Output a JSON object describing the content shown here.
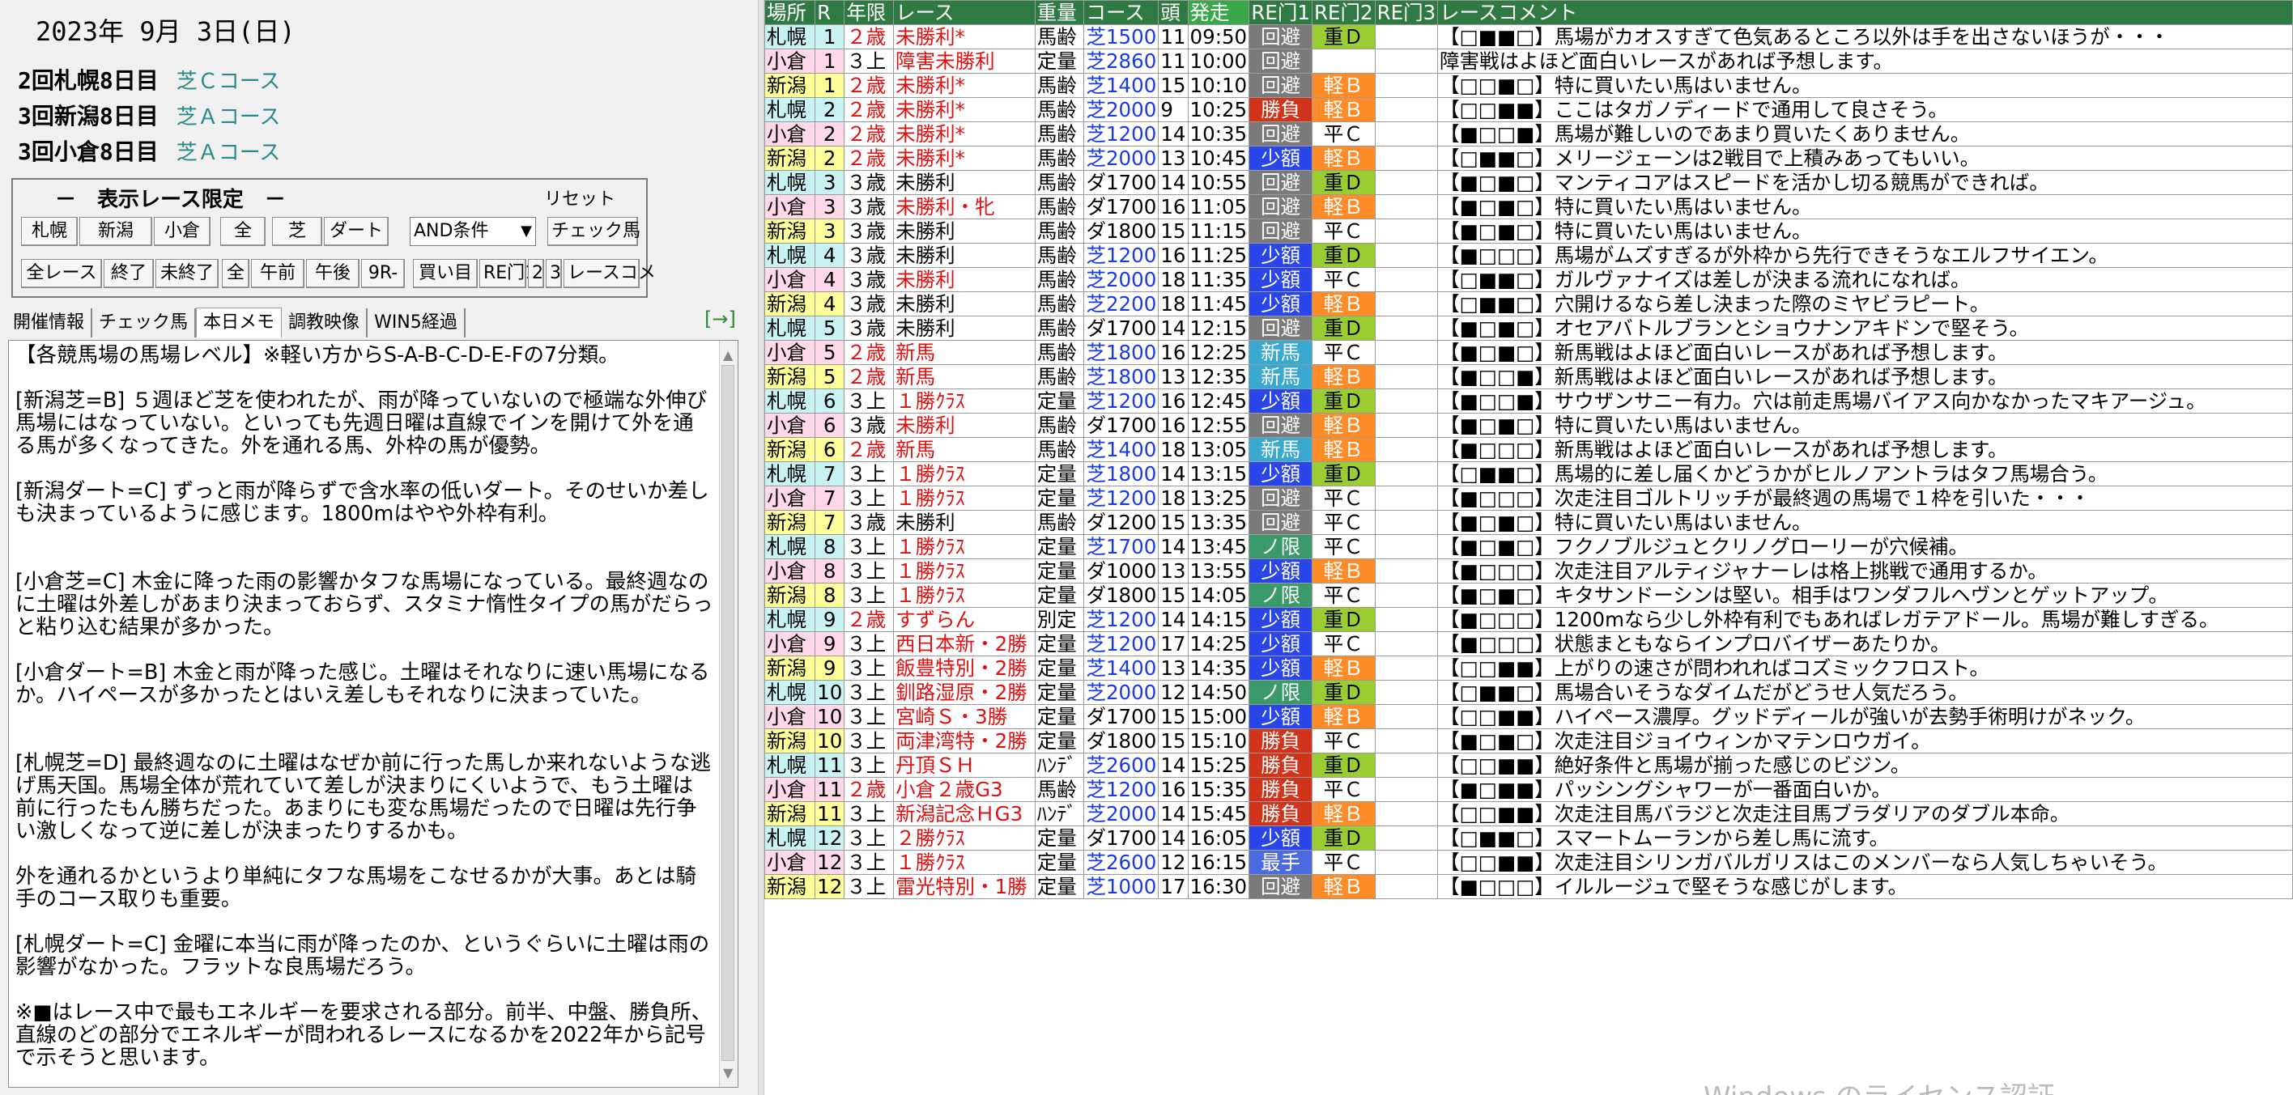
{
  "left": {
    "date": "2023年 9月 3日(日)",
    "venues": [
      {
        "label": "2回札幌8日目",
        "course": "芝Ｃコース"
      },
      {
        "label": "3回新潟8日目",
        "course": "芝Ａコース"
      },
      {
        "label": "3回小倉8日目",
        "course": "芝Ａコース"
      }
    ],
    "filter": {
      "title": "－　表示レース限定　－",
      "reset": "リセット",
      "row1": [
        "札幌",
        "新潟",
        "小倉",
        "全",
        "芝",
        "ダート"
      ],
      "condition": "AND条件",
      "check_horse": "チェック馬",
      "row2": [
        "全レース",
        "終了",
        "未終了",
        "全",
        "午前",
        "午後",
        "9R-",
        "買い目",
        "RE门1",
        "2",
        "3",
        "レースコメ"
      ]
    },
    "tabs": [
      "開催情報",
      "チェック馬",
      "本日メモ",
      "調教映像",
      "WIN5経過"
    ],
    "tab_arrow": "[→]",
    "memo": "【各競馬場の馬場レベル】※軽い方からS-A-B-C-D-E-Fの7分類。\n\n[新潟芝=B] ５週ほど芝を使われたが、雨が降っていないので極端な外伸び馬場にはなっていない。といっても先週日曜は直線でインを開けて外を通る馬が多くなってきた。外を通れる馬、外枠の馬が優勢。\n\n[新潟ダート=C] ずっと雨が降らずで含水率の低いダート。そのせいか差しも決まっているように感じます。1800mはやや外枠有利。\n\n\n[小倉芝=C] 木金に降った雨の影響かタフな馬場になっている。最終週なのに土曜は外差しがあまり決まっておらず、スタミナ惰性タイプの馬がだらっと粘り込む結果が多かった。\n\n[小倉ダート=B] 木金と雨が降った感じ。土曜はそれなりに速い馬場になるか。ハイペースが多かったとはいえ差しもそれなりに決まっていた。\n\n\n[札幌芝=D] 最終週なのに土曜はなぜか前に行った馬しか来れないような逃げ馬天国。馬場全体が荒れていて差しが決まりにくいようで、もう土曜は前に行ったもん勝ちだった。あまりにも変な馬場だったので日曜は先行争い激しくなって逆に差しが決まったりするかも。\n\n外を通れるかというより単純にタフな馬場をこなせるかが大事。あとは騎手のコース取りも重要。\n\n[札幌ダート=C] 金曜に本当に雨が降ったのか、というぐらいに土曜は雨の影響がなかった。フラットな良馬場だろう。\n\n※■はレース中で最もエネルギーを要求される部分。前半、中盤、勝負所、直線のどの部分でエネルギーが問われるレースになるかを2022年から記号で示そうと思います。"
  },
  "table": {
    "headers": [
      "場所",
      "R",
      "年限",
      "レース",
      "重量",
      "コース",
      "頭",
      "発走",
      "RE门1",
      "RE门2",
      "RE门3",
      "レースコメント"
    ],
    "rows": [
      {
        "venue": "札幌",
        "r": "1",
        "age": "２歳",
        "race": "未勝利*",
        "weight": "馬齢",
        "course": "芝1500",
        "heads": "11",
        "time": "09:50",
        "re1": "回避",
        "re2": "重Ｄ",
        "re3": "",
        "comment": "【□■■□】馬場がカオスすぎて色気あるところ以外は手を出さないほうが・・・"
      },
      {
        "venue": "小倉",
        "r": "1",
        "age": "３上",
        "race": "障害未勝利",
        "weight": "定量",
        "course": "芝2860",
        "heads": "11",
        "time": "10:00",
        "re1": "回避",
        "re2": "",
        "re3": "",
        "comment": "障害戦はよほど面白いレースがあれば予想します。"
      },
      {
        "venue": "新潟",
        "r": "1",
        "age": "２歳",
        "race": "未勝利*",
        "weight": "馬齢",
        "course": "芝1400",
        "heads": "15",
        "time": "10:10",
        "re1": "回避",
        "re2": "軽Ｂ",
        "re3": "",
        "comment": "【□□■□】特に買いたい馬はいません。"
      },
      {
        "venue": "札幌",
        "r": "2",
        "age": "２歳",
        "race": "未勝利*",
        "weight": "馬齢",
        "course": "芝2000",
        "heads": "9",
        "time": "10:25",
        "re1": "勝負",
        "re2": "軽Ｂ",
        "re3": "",
        "comment": "【□□■■】ここはタガノディードで通用して良さそう。"
      },
      {
        "venue": "小倉",
        "r": "2",
        "age": "２歳",
        "race": "未勝利*",
        "weight": "馬齢",
        "course": "芝1200",
        "heads": "14",
        "time": "10:35",
        "re1": "回避",
        "re2": "平Ｃ",
        "re3": "",
        "comment": "【■□□■】馬場が難しいのであまり買いたくありません。"
      },
      {
        "venue": "新潟",
        "r": "2",
        "age": "２歳",
        "race": "未勝利*",
        "weight": "馬齢",
        "course": "芝2000",
        "heads": "13",
        "time": "10:45",
        "re1": "少額",
        "re2": "軽Ｂ",
        "re3": "",
        "comment": "【□■■□】メリージェーンは2戦目で上積みあってもいい。"
      },
      {
        "venue": "札幌",
        "r": "3",
        "age": "３歳",
        "race": "未勝利",
        "weight": "馬齢",
        "course": "ダ1700",
        "heads": "14",
        "time": "10:55",
        "re1": "回避",
        "re2": "重Ｄ",
        "re3": "",
        "comment": "【■□■□】マンティコアはスピードを活かし切る競馬ができれば。"
      },
      {
        "venue": "小倉",
        "r": "3",
        "age": "３歳",
        "race": "未勝利・牝",
        "weight": "馬齢",
        "course": "ダ1700",
        "heads": "16",
        "time": "11:05",
        "re1": "回避",
        "re2": "軽Ｂ",
        "re3": "",
        "comment": "【■□■□】特に買いたい馬はいません。"
      },
      {
        "venue": "新潟",
        "r": "3",
        "age": "３歳",
        "race": "未勝利",
        "weight": "馬齢",
        "course": "ダ1800",
        "heads": "15",
        "time": "11:15",
        "re1": "回避",
        "re2": "平Ｃ",
        "re3": "",
        "comment": "【■□■□】特に買いたい馬はいません。"
      },
      {
        "venue": "札幌",
        "r": "4",
        "age": "３歳",
        "race": "未勝利",
        "weight": "馬齢",
        "course": "芝1200",
        "heads": "16",
        "time": "11:25",
        "re1": "少額",
        "re2": "重Ｄ",
        "re3": "",
        "comment": "【■□□□】馬場がムズすぎるが外枠から先行できそうなエルフサイエン。"
      },
      {
        "venue": "小倉",
        "r": "4",
        "age": "３歳",
        "race": "未勝利",
        "weight": "馬齢",
        "course": "芝2000",
        "heads": "18",
        "time": "11:35",
        "re1": "少額",
        "re2": "平Ｃ",
        "re3": "",
        "comment": "【□■■□】ガルヴァナイズは差しが決まる流れになれば。"
      },
      {
        "venue": "新潟",
        "r": "4",
        "age": "３歳",
        "race": "未勝利",
        "weight": "馬齢",
        "course": "芝2200",
        "heads": "18",
        "time": "11:45",
        "re1": "少額",
        "re2": "軽Ｂ",
        "re3": "",
        "comment": "【□■■□】穴開けるなら差し決まった際のミヤビラピート。"
      },
      {
        "venue": "札幌",
        "r": "5",
        "age": "３歳",
        "race": "未勝利",
        "weight": "馬齢",
        "course": "ダ1700",
        "heads": "14",
        "time": "12:15",
        "re1": "回避",
        "re2": "重Ｄ",
        "re3": "",
        "comment": "【■□■□】オセアバトルブランとショウナンアキドンで堅そう。"
      },
      {
        "venue": "小倉",
        "r": "5",
        "age": "２歳",
        "race": "新馬",
        "weight": "馬齢",
        "course": "芝1800",
        "heads": "16",
        "time": "12:25",
        "re1": "新馬",
        "re2": "平Ｃ",
        "re3": "",
        "comment": "【■□■□】新馬戦はよほど面白いレースがあれば予想します。"
      },
      {
        "venue": "新潟",
        "r": "5",
        "age": "２歳",
        "race": "新馬",
        "weight": "馬齢",
        "course": "芝1800",
        "heads": "13",
        "time": "12:35",
        "re1": "新馬",
        "re2": "軽Ｂ",
        "re3": "",
        "comment": "【■□□■】新馬戦はよほど面白いレースがあれば予想します。"
      },
      {
        "venue": "札幌",
        "r": "6",
        "age": "３上",
        "race": "１勝ｸﾗｽ",
        "weight": "定量",
        "course": "芝1200",
        "heads": "16",
        "time": "12:45",
        "re1": "少額",
        "re2": "重Ｄ",
        "re3": "",
        "comment": "【■□□■】サウザンサニー有力。穴は前走馬場バイアス向かなかったマキアージュ。"
      },
      {
        "venue": "小倉",
        "r": "6",
        "age": "３歳",
        "race": "未勝利",
        "weight": "馬齢",
        "course": "ダ1700",
        "heads": "16",
        "time": "12:55",
        "re1": "回避",
        "re2": "軽Ｂ",
        "re3": "",
        "comment": "【■□■□】特に買いたい馬はいません。"
      },
      {
        "venue": "新潟",
        "r": "6",
        "age": "２歳",
        "race": "新馬",
        "weight": "馬齢",
        "course": "芝1400",
        "heads": "18",
        "time": "13:05",
        "re1": "新馬",
        "re2": "軽Ｂ",
        "re3": "",
        "comment": "【■□□□】新馬戦はよほど面白いレースがあれば予想します。"
      },
      {
        "venue": "札幌",
        "r": "7",
        "age": "３上",
        "race": "１勝ｸﾗｽ",
        "weight": "定量",
        "course": "芝1800",
        "heads": "14",
        "time": "13:15",
        "re1": "少額",
        "re2": "重Ｄ",
        "re3": "",
        "comment": "【□■■□】馬場的に差し届くかどうかがヒルノアントラはタフ馬場合う。"
      },
      {
        "venue": "小倉",
        "r": "7",
        "age": "３上",
        "race": "１勝ｸﾗｽ",
        "weight": "定量",
        "course": "芝1200",
        "heads": "18",
        "time": "13:25",
        "re1": "回避",
        "re2": "平Ｃ",
        "re3": "",
        "comment": "【■□□□】次走注目ゴルトリッチが最終週の馬場で１枠を引いた・・・"
      },
      {
        "venue": "新潟",
        "r": "7",
        "age": "３歳",
        "race": "未勝利",
        "weight": "馬齢",
        "course": "ダ1200",
        "heads": "15",
        "time": "13:35",
        "re1": "回避",
        "re2": "平Ｃ",
        "re3": "",
        "comment": "【■□■□】特に買いたい馬はいません。"
      },
      {
        "venue": "札幌",
        "r": "8",
        "age": "３上",
        "race": "１勝ｸﾗｽ",
        "weight": "定量",
        "course": "芝1700",
        "heads": "14",
        "time": "13:45",
        "re1": "ノ限",
        "re2": "平Ｃ",
        "re3": "",
        "comment": "【■□■□】フクノブルジュとクリノグローリーが穴候補。"
      },
      {
        "venue": "小倉",
        "r": "8",
        "age": "３上",
        "race": "１勝ｸﾗｽ",
        "weight": "定量",
        "course": "ダ1000",
        "heads": "13",
        "time": "13:55",
        "re1": "少額",
        "re2": "軽Ｂ",
        "re3": "",
        "comment": "【■□□□】次走注目アルティジャナーレは格上挑戦で通用するか。"
      },
      {
        "venue": "新潟",
        "r": "8",
        "age": "３上",
        "race": "１勝ｸﾗｽ",
        "weight": "定量",
        "course": "ダ1800",
        "heads": "15",
        "time": "14:05",
        "re1": "ノ限",
        "re2": "平Ｃ",
        "re3": "",
        "comment": "【■□■□】キタサンドーシンは堅い。相手はワンダフルヘヴンとゲットアップ。"
      },
      {
        "venue": "札幌",
        "r": "9",
        "age": "２歳",
        "race": "すずらん",
        "weight": "別定",
        "course": "芝1200",
        "heads": "14",
        "time": "14:15",
        "re1": "少額",
        "re2": "重Ｄ",
        "re3": "",
        "comment": "【■□□□】1200mなら少し外枠有利でもあればレガテアドール。馬場が難しすぎる。"
      },
      {
        "venue": "小倉",
        "r": "9",
        "age": "３上",
        "race": "西日本新・2勝",
        "weight": "定量",
        "course": "芝1200",
        "heads": "17",
        "time": "14:25",
        "re1": "少額",
        "re2": "平Ｃ",
        "re3": "",
        "comment": "【■□□□】状態まともならインプロバイザーあたりか。"
      },
      {
        "venue": "新潟",
        "r": "9",
        "age": "３上",
        "race": "飯豊特別・2勝",
        "weight": "定量",
        "course": "芝1400",
        "heads": "13",
        "time": "14:35",
        "re1": "少額",
        "re2": "軽Ｂ",
        "re3": "",
        "comment": "【□□■■】上がりの速さが問われればコズミックフロスト。"
      },
      {
        "venue": "札幌",
        "r": "10",
        "age": "３上",
        "race": "釧路湿原・2勝",
        "weight": "定量",
        "course": "芝2000",
        "heads": "12",
        "time": "14:50",
        "re1": "ノ限",
        "re2": "重Ｄ",
        "re3": "",
        "comment": "【□■■□】馬場合いそうなダイムだがどうせ人気だろう。"
      },
      {
        "venue": "小倉",
        "r": "10",
        "age": "３上",
        "race": "宮崎Ｓ・3勝",
        "weight": "定量",
        "course": "ダ1700",
        "heads": "15",
        "time": "15:00",
        "re1": "少額",
        "re2": "軽Ｂ",
        "re3": "",
        "comment": "【□□■■】ハイペース濃厚。グッドディールが強いが去勢手術明けがネック。"
      },
      {
        "venue": "新潟",
        "r": "10",
        "age": "３上",
        "race": "両津湾特・2勝",
        "weight": "定量",
        "course": "ダ1800",
        "heads": "15",
        "time": "15:10",
        "re1": "勝負",
        "re2": "平Ｃ",
        "re3": "",
        "comment": "【■□■□】次走注目ジョイウィンかマテンロウガイ。"
      },
      {
        "venue": "札幌",
        "r": "11",
        "age": "３上",
        "race": "丹頂ＳＨ",
        "weight": "ﾊﾝﾃﾞ",
        "course": "芝2600",
        "heads": "14",
        "time": "15:25",
        "re1": "勝負",
        "re2": "重Ｄ",
        "re3": "",
        "comment": "【□□■■】絶好条件と馬場が揃った感じのビジン。"
      },
      {
        "venue": "小倉",
        "r": "11",
        "age": "２歳",
        "race": "小倉２歳G3",
        "weight": "馬齢",
        "course": "芝1200",
        "heads": "16",
        "time": "15:35",
        "re1": "勝負",
        "re2": "平Ｃ",
        "re3": "",
        "comment": "【■□■■】パッシングシャワーが一番面白いか。"
      },
      {
        "venue": "新潟",
        "r": "11",
        "age": "３上",
        "race": "新潟記念ＨG3",
        "weight": "ﾊﾝﾃﾞ",
        "course": "芝2000",
        "heads": "14",
        "time": "15:45",
        "re1": "勝負",
        "re2": "軽Ｂ",
        "re3": "",
        "comment": "【□□■■】次走注目馬バラジと次走注目馬ブラダリアのダブル本命。"
      },
      {
        "venue": "札幌",
        "r": "12",
        "age": "３上",
        "race": "２勝ｸﾗｽ",
        "weight": "定量",
        "course": "ダ1700",
        "heads": "14",
        "time": "16:05",
        "re1": "少額",
        "re2": "重Ｄ",
        "re3": "",
        "comment": "【□■■□】スマートムーランから差し馬に流す。"
      },
      {
        "venue": "小倉",
        "r": "12",
        "age": "３上",
        "race": "１勝ｸﾗｽ",
        "weight": "定量",
        "course": "芝2600",
        "heads": "12",
        "time": "16:15",
        "re1": "最手",
        "re2": "平Ｃ",
        "re3": "",
        "comment": "【□□■■】次走注目シリンガバルガリスはこのメンバーなら人気しちゃいそう。"
      },
      {
        "venue": "新潟",
        "r": "12",
        "age": "３上",
        "race": "雷光特別・1勝",
        "weight": "定量",
        "course": "芝1000",
        "heads": "17",
        "time": "16:30",
        "re1": "回避",
        "re2": "軽Ｂ",
        "re3": "",
        "comment": "【■□□□】イルルージュで堅そうな感じがします。"
      }
    ]
  },
  "watermark": "Windows のライセンス認証"
}
